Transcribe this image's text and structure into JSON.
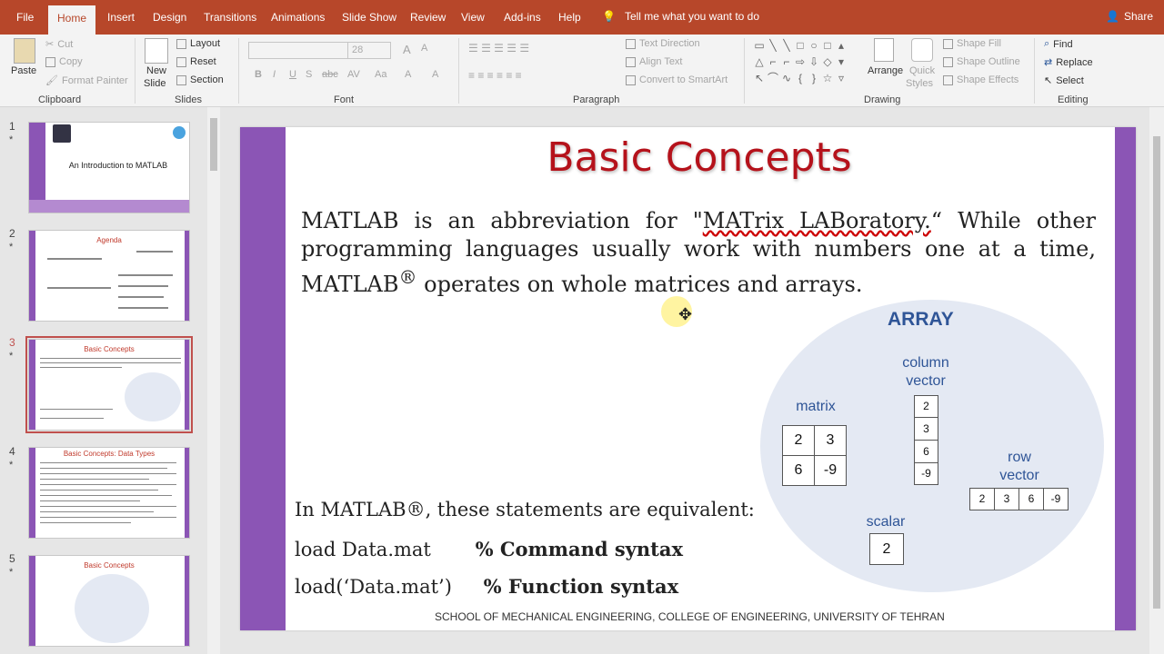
{
  "ribbon_tabs": [
    "File",
    "Home",
    "Insert",
    "Design",
    "Transitions",
    "Animations",
    "Slide Show",
    "Review",
    "View",
    "Add-ins",
    "Help"
  ],
  "tell_me": "Tell me what you want to do",
  "share": "Share",
  "clipboard": {
    "paste": "Paste",
    "cut": "Cut",
    "copy": "Copy",
    "format_painter": "Format Painter",
    "label": "Clipboard"
  },
  "slides_group": {
    "new_slide_1": "New",
    "new_slide_2": "Slide",
    "layout": "Layout",
    "reset": "Reset",
    "section": "Section",
    "label": "Slides"
  },
  "font_group": {
    "size": "28",
    "label": "Font",
    "bold": "B",
    "italic": "I",
    "underline": "U",
    "strike": "S",
    "abc": "abc",
    "av": "AV",
    "aa": "Aa",
    "a": "A"
  },
  "paragraph_group": {
    "text_direction": "Text Direction",
    "align_text": "Align Text",
    "convert_smartart": "Convert to SmartArt",
    "label": "Paragraph"
  },
  "drawing_group": {
    "arrange": "Arrange",
    "quick_styles_1": "Quick",
    "quick_styles_2": "Styles",
    "shape_fill": "Shape Fill",
    "shape_outline": "Shape Outline",
    "shape_effects": "Shape Effects",
    "label": "Drawing"
  },
  "editing_group": {
    "find": "Find",
    "replace": "Replace",
    "select": "Select",
    "label": "Editing"
  },
  "thumbnails": [
    {
      "num": "1",
      "star": "*",
      "title": "An Introduction to MATLAB"
    },
    {
      "num": "2",
      "star": "*",
      "title": "Agenda"
    },
    {
      "num": "3",
      "star": "*",
      "title": "Basic Concepts"
    },
    {
      "num": "4",
      "star": "*",
      "title": "Basic Concepts: Data Types"
    },
    {
      "num": "5",
      "star": "*",
      "title": "Basic Concepts"
    }
  ],
  "slide": {
    "title": "Basic Concepts",
    "body_1": "MATLAB is an abbreviation for \"",
    "body_underlined": "MATrix LABoratory.",
    "body_2": "“ While other programming languages usually work with numbers one at a time, MATLAB",
    "body_reg": "®",
    "body_3": " operates on whole matrices and arrays.",
    "stmt_intro": "In MATLAB®, these statements are equivalent:",
    "stmt_cmd_code": "load Data.mat",
    "stmt_cmd_comment": "% Command syntax",
    "stmt_fn_code": "load(‘Data.mat’)",
    "stmt_fn_comment": "% Function syntax",
    "footer": "SCHOOL OF MECHANICAL ENGINEERING, COLLEGE OF ENGINEERING, UNIVERSITY OF TEHRAN",
    "diagram": {
      "title": "ARRAY",
      "matrix_label": "matrix",
      "matrix": [
        "2",
        "3",
        "6",
        "-9"
      ],
      "column_label": "column vector",
      "column": [
        "2",
        "3",
        "6",
        "-9"
      ],
      "row_label": "row vector",
      "row": [
        "2",
        "3",
        "6",
        "-9"
      ],
      "scalar_label": "scalar",
      "scalar": "2"
    }
  },
  "colors": {
    "ribbon": "#b7472a",
    "accent_bar": "#8b55b5",
    "title_red": "#b5121b",
    "diagram_blue": "#2f5597"
  }
}
